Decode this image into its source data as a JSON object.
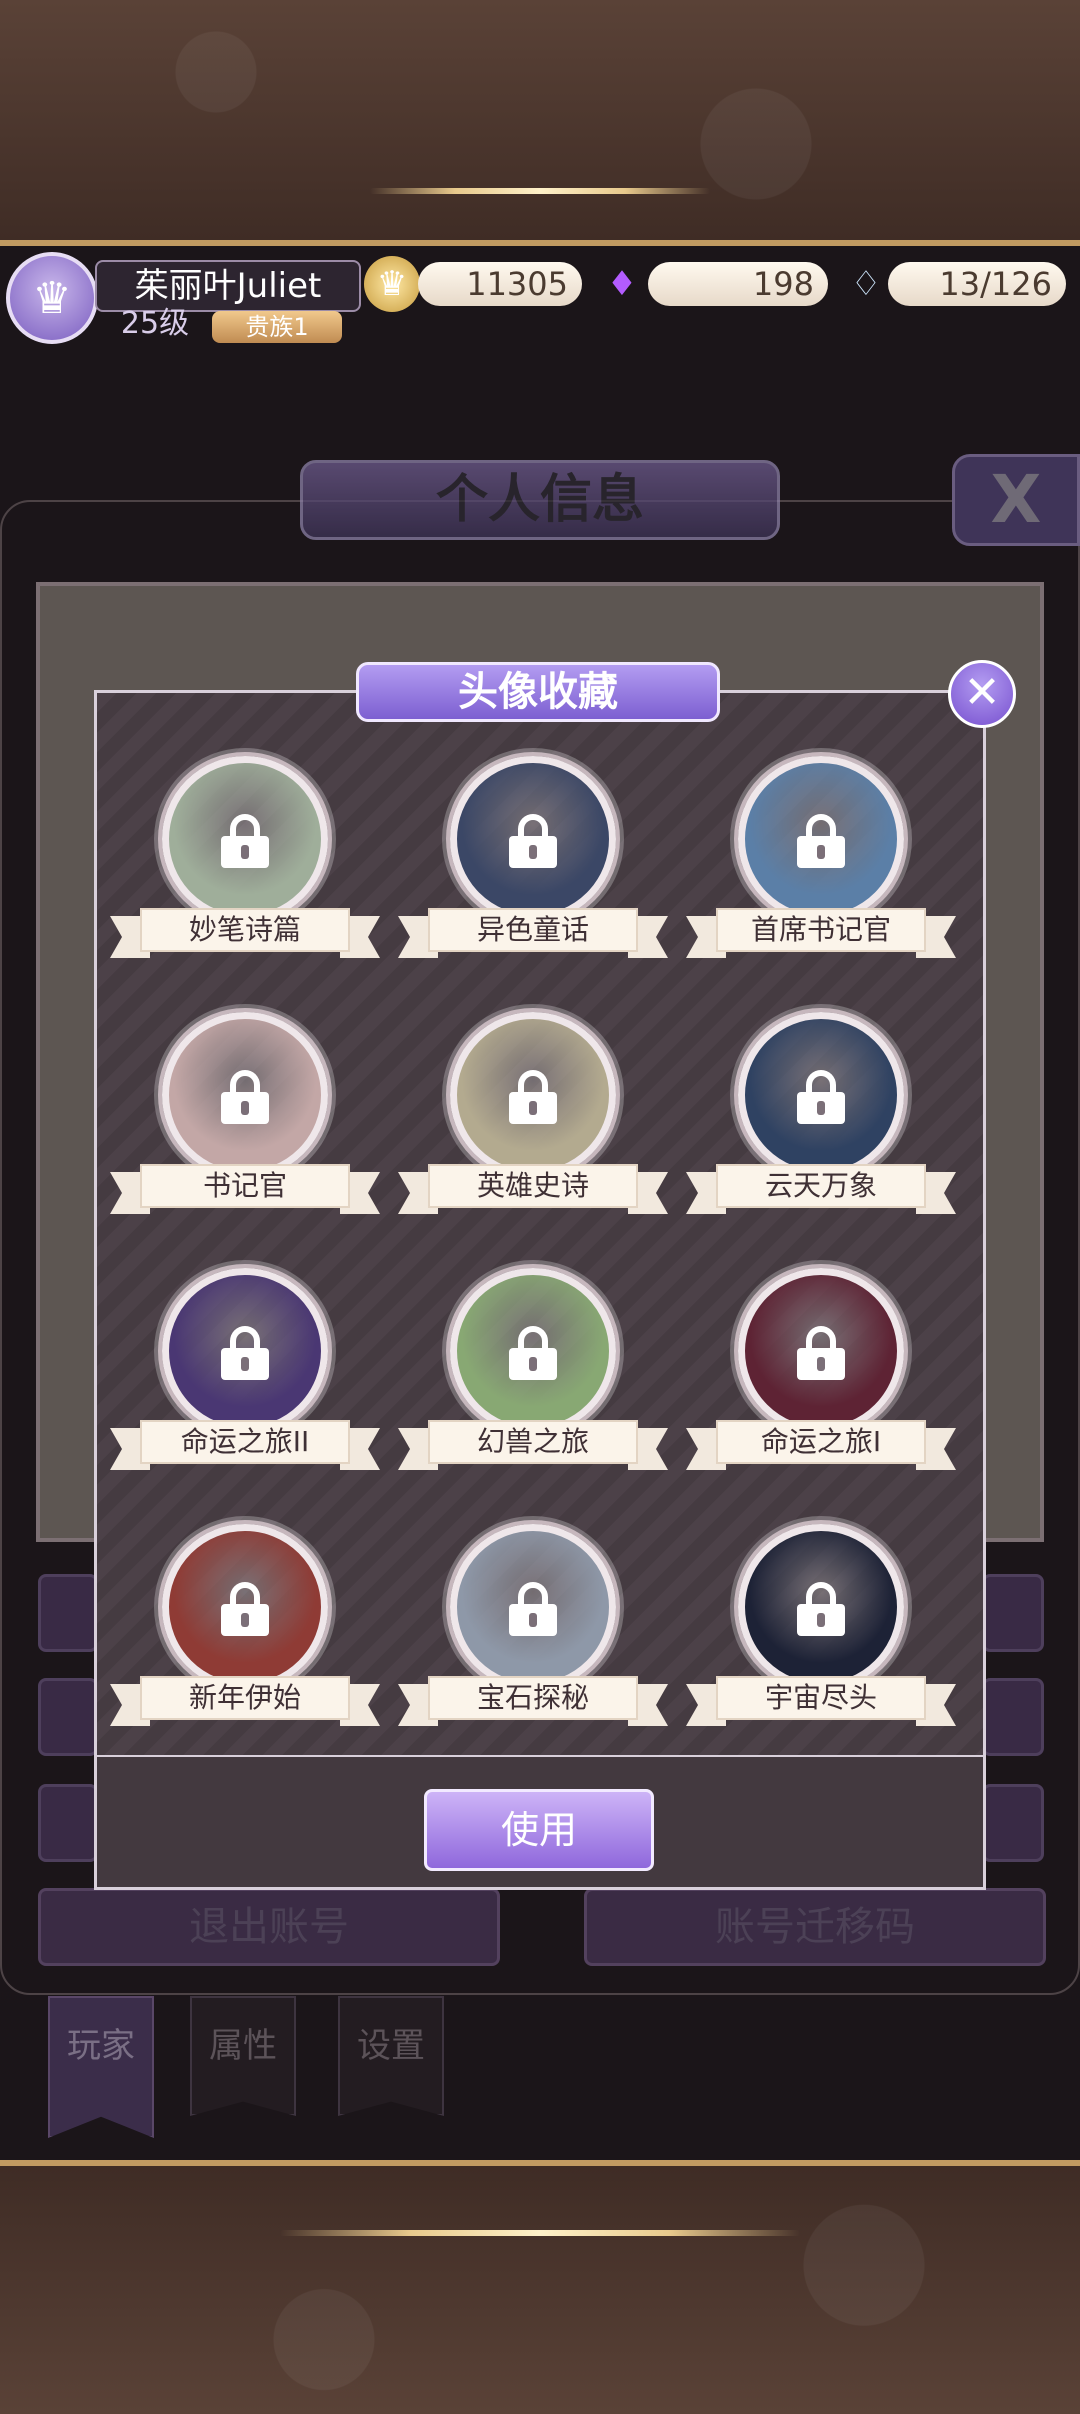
{
  "header": {
    "player_name": "茱丽叶Juliet",
    "level": "25级",
    "title_badge": "贵族1",
    "gold": "11305",
    "gems": "198",
    "stamina": "13/126"
  },
  "info_panel": {
    "title": "个人信息",
    "close_symbol": "X",
    "buttons": {
      "logout": "退出账号",
      "transfer_code": "账号迁移码"
    },
    "tabs": [
      "玩家",
      "属性",
      "设置"
    ]
  },
  "modal": {
    "title": "头像收藏",
    "close_symbol": "✕",
    "use_button": "使用",
    "avatars": [
      {
        "name": "妙笔诗篇",
        "locked": true,
        "color": "#9fae9a"
      },
      {
        "name": "异色童话",
        "locked": true,
        "color": "#3b4766"
      },
      {
        "name": "首席书记官",
        "locked": true,
        "color": "#5b7fa7"
      },
      {
        "name": "书记官",
        "locked": true,
        "color": "#c3a7a6"
      },
      {
        "name": "英雄史诗",
        "locked": true,
        "color": "#b3aa8f"
      },
      {
        "name": "云天万象",
        "locked": true,
        "color": "#2f4262"
      },
      {
        "name": "命运之旅II",
        "locked": true,
        "color": "#4a3773"
      },
      {
        "name": "幻兽之旅",
        "locked": true,
        "color": "#88a873"
      },
      {
        "name": "命运之旅I",
        "locked": true,
        "color": "#5e2334"
      },
      {
        "name": "新年伊始",
        "locked": true,
        "color": "#8f3b35"
      },
      {
        "name": "宝石探秘",
        "locked": true,
        "color": "#8e98a8"
      },
      {
        "name": "宇宙尽头",
        "locked": true,
        "color": "#1d2236"
      }
    ]
  }
}
